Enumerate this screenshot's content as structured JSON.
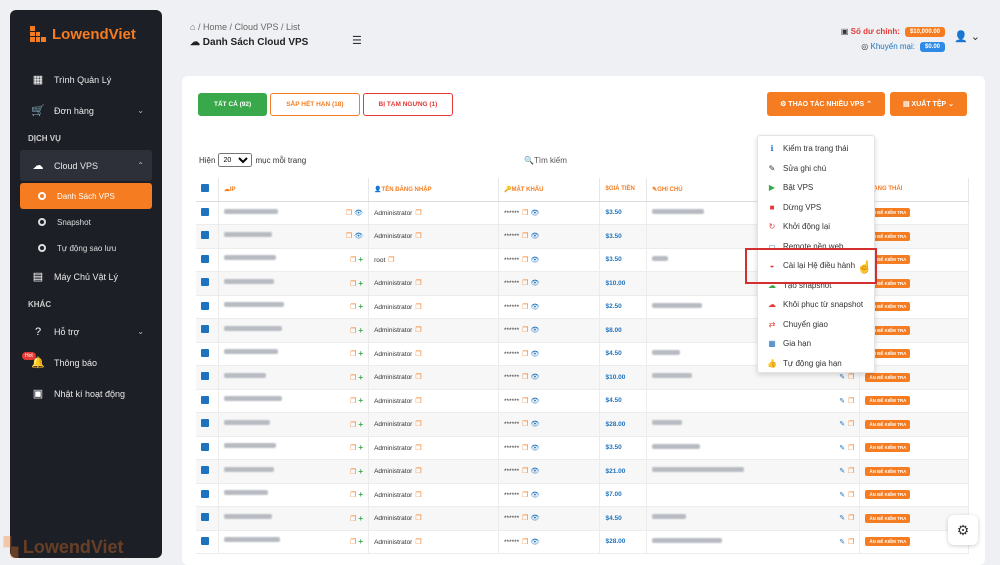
{
  "brand": "LowendViet",
  "sidebar": {
    "items": [
      {
        "label": "Trình Quản Lý",
        "icon": "dashboard-icon"
      },
      {
        "label": "Đơn hàng",
        "icon": "cart-icon"
      }
    ],
    "section_services": "DỊCH VỤ",
    "cloud": "Cloud VPS",
    "subs": [
      "Danh Sách VPS",
      "Snapshot",
      "Tự động sao lưu"
    ],
    "physical": "Máy Chủ Vật Lý",
    "section_other": "KHÁC",
    "support": "Hỗ trợ",
    "hot": "Hot",
    "notice": "Thông báo",
    "log": "Nhật kí hoạt động"
  },
  "breadcrumb": {
    "home": "Home",
    "cloud": "Cloud VPS",
    "list": "List"
  },
  "page_title": "Danh Sách Cloud VPS",
  "account": {
    "balance_label": "Số dư chính:",
    "balance": "$10,000.00",
    "promo_label": "Khuyến mại:",
    "promo": "$0.00"
  },
  "tabs": {
    "all": "TẤT CẢ (92)",
    "expiring": "SẮP HẾT HẠN (18)",
    "suspended": "BỊ TẠM NGƯNG (1)"
  },
  "actions": {
    "bulk": "THAO TÁC NHIỀU VPS",
    "export": "XUẤT TỆP"
  },
  "controls": {
    "show": "Hiện",
    "entries": "20",
    "per_page": "mục mỗi trang",
    "search": "Tìm kiếm"
  },
  "columns": {
    "ip": "IP",
    "user": "TÊN ĐĂNG NHẬP",
    "pass": "MẬT KHẨU",
    "price": "GIÁ TIỀN",
    "note": "GHI CHÚ",
    "status": "TRẠNG THÁI"
  },
  "rows": [
    {
      "user": "Administrator",
      "pass": "******",
      "price": "$3.50",
      "status": "ẤN ĐỂ KIỂM TRA"
    },
    {
      "user": "Administrator",
      "pass": "******",
      "price": "$3.50",
      "status": "ẤN ĐỂ KIỂM TRA"
    },
    {
      "user": "root",
      "pass": "******",
      "price": "$3.50",
      "status": "ẤN ĐỂ KIỂM TRA"
    },
    {
      "user": "Administrator",
      "pass": "******",
      "price": "$10.00",
      "status": "ẤN ĐỂ KIỂM TRA"
    },
    {
      "user": "Administrator",
      "pass": "******",
      "price": "$2.50",
      "status": "ẤN ĐỂ KIỂM TRA"
    },
    {
      "user": "Administrator",
      "pass": "******",
      "price": "$8.00",
      "status": "ẤN ĐỂ KIỂM TRA"
    },
    {
      "user": "Administrator",
      "pass": "******",
      "price": "$4.50",
      "status": "ẤN ĐỂ KIỂM TRA"
    },
    {
      "user": "Administrator",
      "pass": "******",
      "price": "$10.00",
      "status": "ẤN ĐỂ KIỂM TRA"
    },
    {
      "user": "Administrator",
      "pass": "******",
      "price": "$4.50",
      "status": "ẤN ĐỂ KIỂM TRA"
    },
    {
      "user": "Administrator",
      "pass": "******",
      "price": "$28.00",
      "status": "ẤN ĐỂ KIỂM TRA"
    },
    {
      "user": "Administrator",
      "pass": "******",
      "price": "$3.50",
      "status": "ẤN ĐỂ KIỂM TRA"
    },
    {
      "user": "Administrator",
      "pass": "******",
      "price": "$21.00",
      "status": "ẤN ĐỂ KIỂM TRA"
    },
    {
      "user": "Administrator",
      "pass": "******",
      "price": "$7.00",
      "status": "ẤN ĐỂ KIỂM TRA"
    },
    {
      "user": "Administrator",
      "pass": "******",
      "price": "$4.50",
      "status": "ẤN ĐỂ KIỂM TRA"
    },
    {
      "user": "Administrator",
      "pass": "******",
      "price": "$28.00",
      "status": "ẤN ĐỂ KIỂM TRA"
    }
  ],
  "dropdown": [
    {
      "label": "Kiểm tra trạng thái",
      "icon": "info-icon",
      "color": "#1e73be"
    },
    {
      "label": "Sửa ghi chú",
      "icon": "edit-icon",
      "color": "#333333"
    },
    {
      "label": "Bật VPS",
      "icon": "play-icon",
      "color": "#39a84a"
    },
    {
      "label": "Dừng VPS",
      "icon": "stop-icon",
      "color": "#e53935"
    },
    {
      "label": "Khởi động lại",
      "icon": "restart-icon",
      "color": "#e53935"
    },
    {
      "label": "Remote nền web",
      "icon": "monitor-icon",
      "color": "#1e73be"
    },
    {
      "label": "Cài lại Hệ điều hành",
      "icon": "hat-icon",
      "color": "#e53935"
    },
    {
      "label": "Tạo snapshot",
      "icon": "cloud-plus-icon",
      "color": "#39a84a"
    },
    {
      "label": "Khôi phục từ snapshot",
      "icon": "cloud-restore-icon",
      "color": "#e53935"
    },
    {
      "label": "Chuyển giao",
      "icon": "transfer-icon",
      "color": "#e53935"
    },
    {
      "label": "Gia hạn",
      "icon": "calendar-icon",
      "color": "#1e73be"
    },
    {
      "label": "Tự động gia hạn",
      "icon": "thumbs-up-icon",
      "color": "#1e73be"
    }
  ],
  "colors": {
    "accent": "#f57c20",
    "sidebar": "#1d1f27"
  }
}
